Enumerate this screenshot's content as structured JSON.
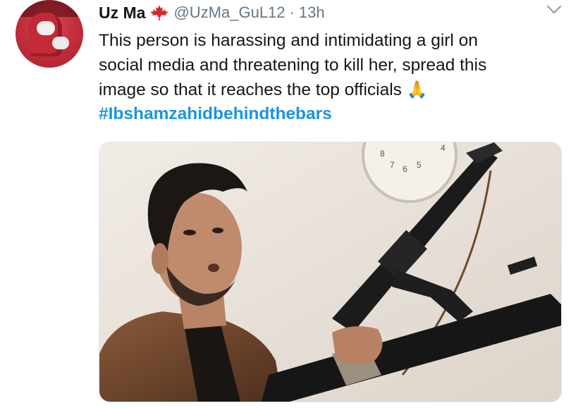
{
  "tweet": {
    "author_name": "Uz Ma",
    "flag_icon": "maple-leaf",
    "handle": "@UzMa_GuL12",
    "separator": "·",
    "time": "13h",
    "text_lines": [
      "This person is harassing and intimidating a girl on",
      "social media and threatening to kill her, spread this",
      "image so that it reaches the top officials"
    ],
    "emoji": "🙏",
    "hashtag": "#Ibshamzahidbehindthebars"
  },
  "media": {
    "clock_numbers": [
      "8",
      "7",
      "6",
      "5",
      "4"
    ]
  },
  "colors": {
    "text": "#14171a",
    "secondary": "#657786",
    "link": "#1b95e0",
    "flag": "#d7262e"
  }
}
